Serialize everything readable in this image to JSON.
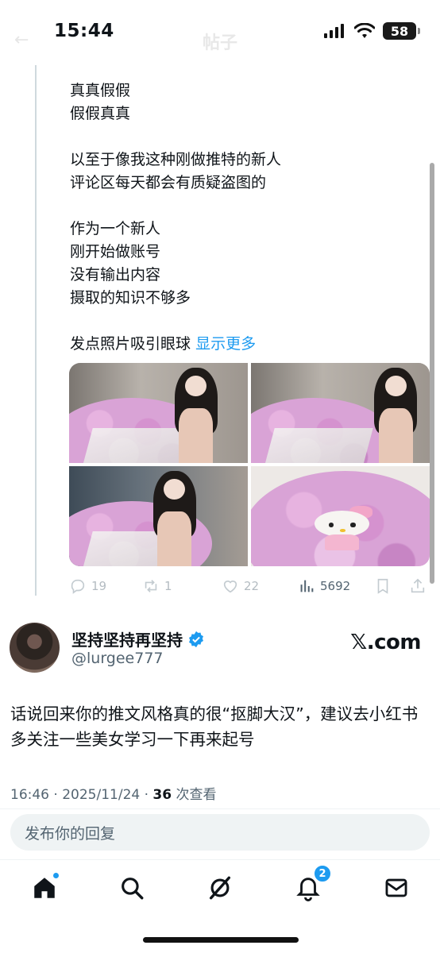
{
  "status_bar": {
    "time": "15:44",
    "battery": "58"
  },
  "header": {
    "ghost_title": "帖子"
  },
  "quoted_tweet": {
    "lines": [
      "真真假假",
      "假假真真",
      "",
      "以至于像我这种刚做推特的新人",
      "评论区每天都会有质疑盗图的",
      "",
      "作为一个新人",
      "刚开始做账号",
      "没有输出内容",
      "摄取的知识不够多",
      ""
    ],
    "last_line": "发点照片吸引眼球",
    "show_more": "显示更多",
    "actions": {
      "replies": "19",
      "reposts": "1",
      "likes": "22",
      "views": "5692"
    }
  },
  "reply_tweet": {
    "display_name": "坚持坚持再坚持",
    "handle": "@lurgee777",
    "watermark": "𝕏.com",
    "text": "话说回来你的推文风格真的很“抠脚大汉”，建议去小红书多关注一些美女学习一下再来起号",
    "time": "16:46",
    "date": "2025/11/24",
    "views_count": "36",
    "views_label": "次查看"
  },
  "reply_box": {
    "placeholder": "发布你的回复"
  },
  "bottom_nav": {
    "notifications_badge": "2"
  }
}
